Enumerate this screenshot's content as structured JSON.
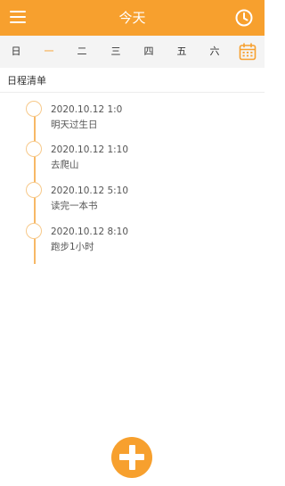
{
  "header": {
    "title": "今天",
    "menu_icon": "menu-icon",
    "clock_icon": "clock-icon"
  },
  "weekdays": {
    "days": [
      "日",
      "一",
      "二",
      "三",
      "四",
      "五",
      "六"
    ],
    "selected": "一",
    "calendar_icon": "calendar-icon"
  },
  "section": {
    "title": "日程清单"
  },
  "schedule": {
    "items": [
      {
        "time": "2020.10.12 1:0",
        "text": "明天过生日"
      },
      {
        "time": "2020.10.12 1:10",
        "text": "去爬山"
      },
      {
        "time": "2020.10.12 5:10",
        "text": "读完一本书"
      },
      {
        "time": "2020.10.12 8:10",
        "text": "跑步1小时"
      }
    ]
  },
  "fab": {
    "icon": "plus-icon"
  },
  "colors": {
    "accent": "#f7a02e",
    "week_bar": "#f4f4f4",
    "timeline": "#f7b866"
  }
}
